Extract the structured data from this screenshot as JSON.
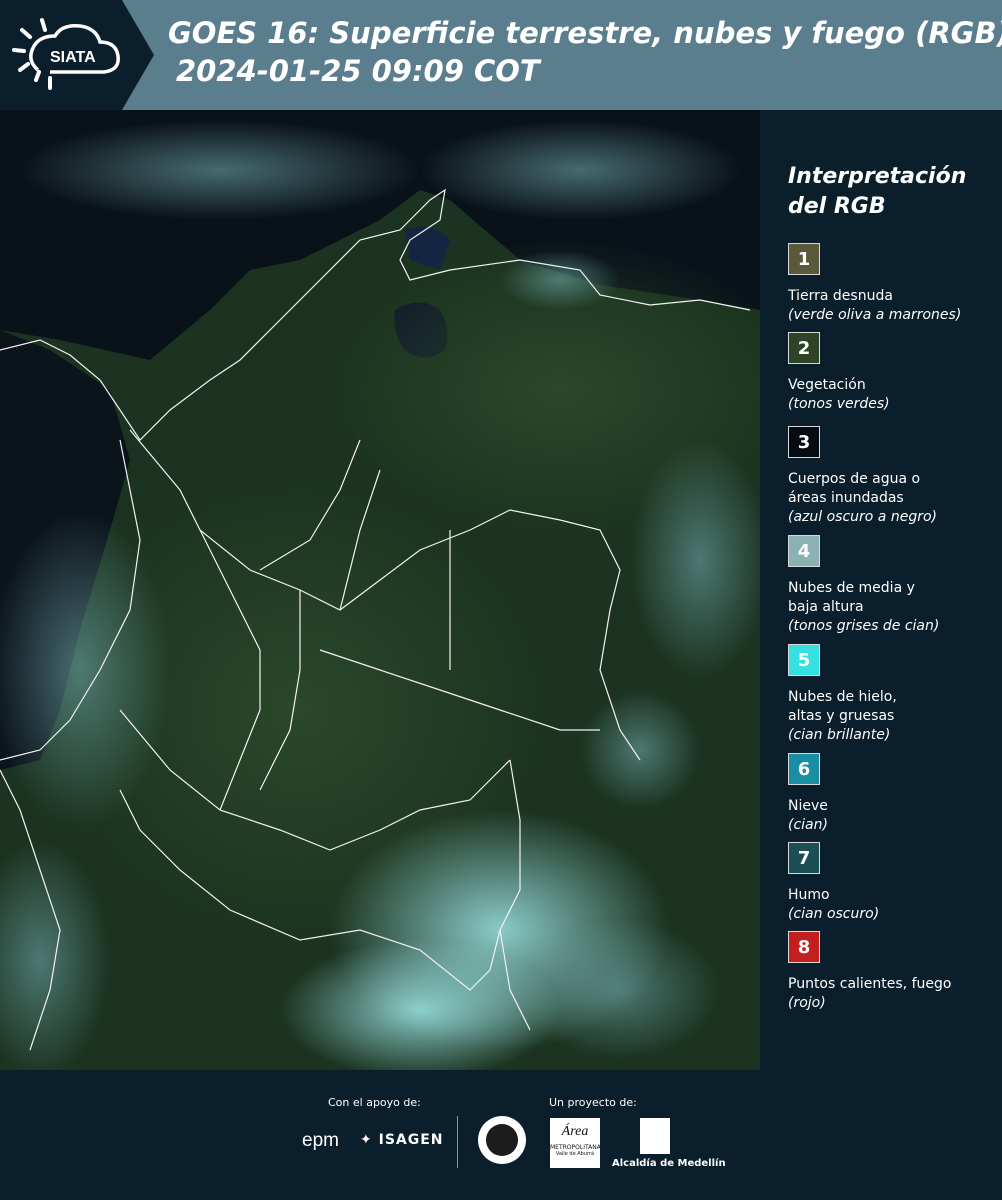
{
  "header": {
    "logo_text": "SIATA",
    "title_line1": "GOES 16: Superficie terrestre, nubes y fuego (RGB)",
    "title_line2": "2024-01-25 09:09 COT"
  },
  "legend": {
    "title": "Interpretación\ndel RGB",
    "items": [
      {
        "num": "1",
        "label": "Tierra desnuda",
        "sub": "(verde oliva a marrones)",
        "color": "#5a5a3a"
      },
      {
        "num": "2",
        "label": "Vegetación",
        "sub": "(tonos verdes)",
        "color": "#2f4426"
      },
      {
        "num": "3",
        "label": "Cuerpos de agua o\náreas inundadas",
        "sub": "(azul oscuro a negro)",
        "color": "#070b12"
      },
      {
        "num": "4",
        "label": "Nubes de media y\nbaja altura",
        "sub": "(tonos grises de cian)",
        "color": "#8ab2b2"
      },
      {
        "num": "5",
        "label": "Nubes de hielo,\naltas y gruesas",
        "sub": "(cian brillante)",
        "color": "#37e0e0"
      },
      {
        "num": "6",
        "label": "Nieve",
        "sub": "(cian)",
        "color": "#1a8ea3"
      },
      {
        "num": "7",
        "label": "Humo",
        "sub": "(cian oscuro)",
        "color": "#1c4f55"
      },
      {
        "num": "8",
        "label": "Puntos calientes, fuego",
        "sub": "(rojo)",
        "color": "#c41f1f"
      }
    ]
  },
  "footer": {
    "support_label": "Con el apoyo de:",
    "project_label": "Un proyecto de:",
    "epm": "epm",
    "isagen": "ISAGEN",
    "area_word": "Área",
    "area_sub": "METROPOLITANA",
    "area_sub2": "Valle de Aburrá",
    "alcaldia": "Alcaldía de Medellín"
  }
}
